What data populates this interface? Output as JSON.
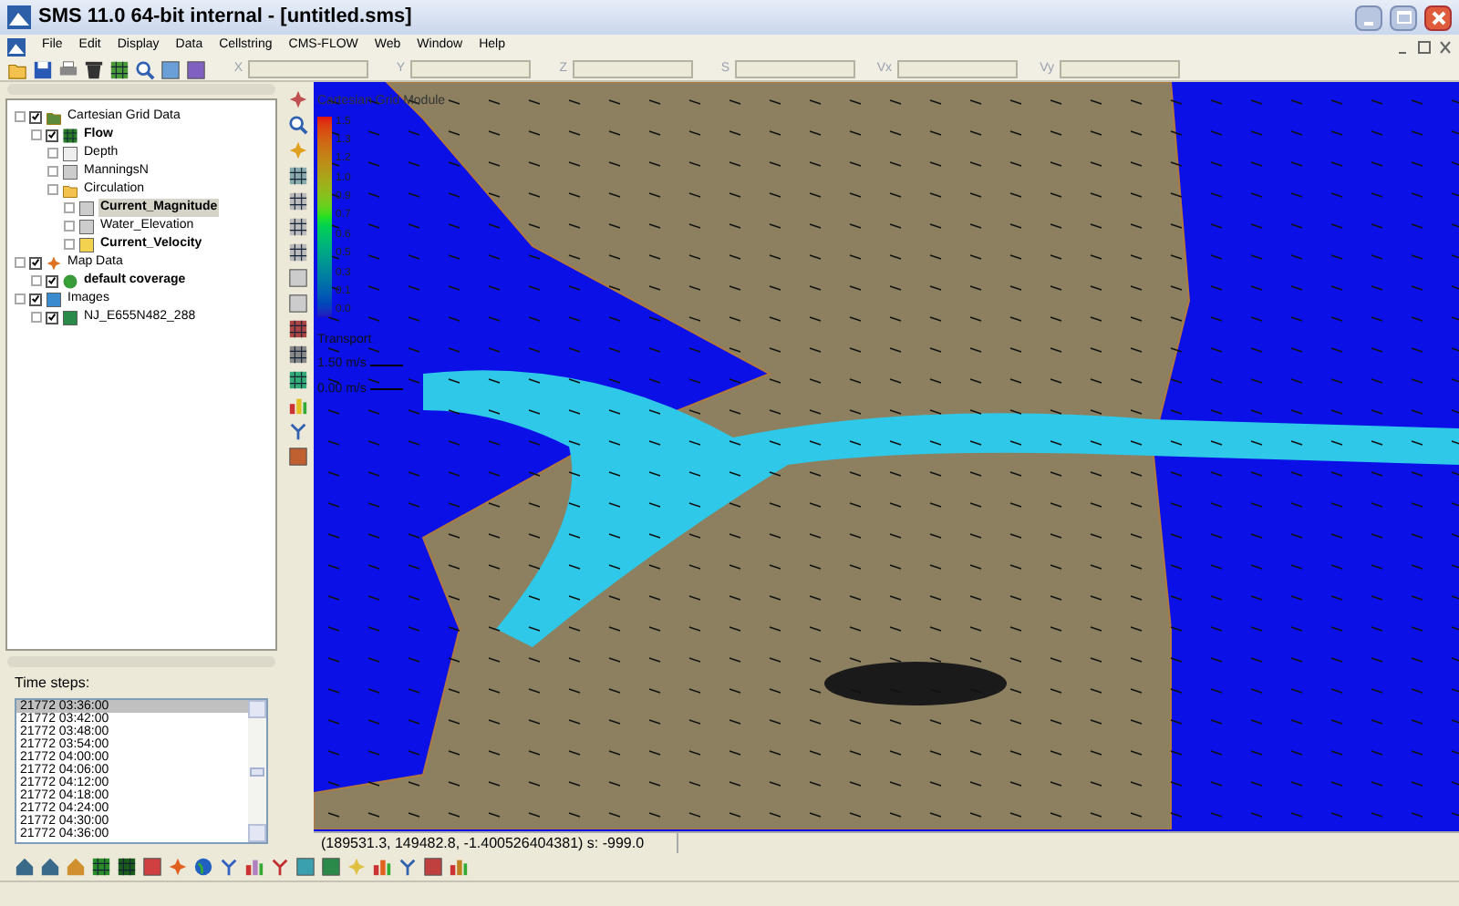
{
  "window": {
    "title": "SMS 11.0 64-bit internal - [untitled.sms]"
  },
  "menu": [
    "File",
    "Edit",
    "Display",
    "Data",
    "Cellstring",
    "CMS-FLOW",
    "Web",
    "Window",
    "Help"
  ],
  "coord_fields": [
    {
      "label": "X"
    },
    {
      "label": "Y"
    },
    {
      "label": "Z"
    },
    {
      "label": "S"
    },
    {
      "label": "Vx"
    },
    {
      "label": "Vy"
    }
  ],
  "tree": [
    {
      "label": "Cartesian Grid Data",
      "kind": "gridfolder",
      "checked": true,
      "bold": false,
      "selected": false,
      "children": [
        {
          "label": "Flow",
          "kind": "grid",
          "checked": true,
          "bold": true,
          "selected": false,
          "children": [
            {
              "label": "Depth",
              "kind": "z",
              "bold": false,
              "selected": false
            },
            {
              "label": "ManningsN",
              "kind": "scalar",
              "bold": false,
              "selected": false
            },
            {
              "label": "Circulation",
              "kind": "folder",
              "bold": false,
              "selected": false,
              "children": [
                {
                  "label": "Current_Magnitude",
                  "kind": "scalar",
                  "bold": true,
                  "selected": true
                },
                {
                  "label": "Water_Elevation",
                  "kind": "scalar",
                  "bold": false,
                  "selected": false
                },
                {
                  "label": "Current_Velocity",
                  "kind": "vector",
                  "bold": true,
                  "selected": false
                }
              ]
            }
          ]
        }
      ]
    },
    {
      "label": "Map Data",
      "kind": "map",
      "checked": true,
      "bold": false,
      "selected": false,
      "children": [
        {
          "label": "default coverage",
          "kind": "coverage",
          "checked": true,
          "bold": true,
          "selected": false
        }
      ]
    },
    {
      "label": "Images",
      "kind": "images",
      "checked": true,
      "bold": false,
      "selected": false,
      "children": [
        {
          "label": "NJ_E655N482_288",
          "kind": "image",
          "checked": true,
          "bold": false,
          "selected": false
        }
      ]
    }
  ],
  "time_steps": {
    "label": "Time steps:",
    "items": [
      {
        "text": "21772 03:36:00",
        "selected": true
      },
      {
        "text": "21772 03:42:00",
        "selected": false
      },
      {
        "text": "21772 03:48:00",
        "selected": false
      },
      {
        "text": "21772 03:54:00",
        "selected": false
      },
      {
        "text": "21772 04:00:00",
        "selected": false
      },
      {
        "text": "21772 04:06:00",
        "selected": false
      },
      {
        "text": "21772 04:12:00",
        "selected": false
      },
      {
        "text": "21772 04:18:00",
        "selected": false
      },
      {
        "text": "21772 04:24:00",
        "selected": false
      },
      {
        "text": "21772 04:30:00",
        "selected": false
      },
      {
        "text": "21772 04:36:00",
        "selected": false
      }
    ]
  },
  "map": {
    "title": "Cartesian Grid Module",
    "legend": [
      "1.5",
      "1.3",
      "1.2",
      "1.0",
      "0.9",
      "0.7",
      "0.6",
      "0.5",
      "0.3",
      "0.1",
      "0.0"
    ],
    "vector_legend": {
      "title": "Transport",
      "max": "1.50 m/s",
      "min": "0.00 m/s"
    }
  },
  "status_bar": {
    "coordinates": "(189531.3, 149482.8, -1.400526404381) s: -999.0"
  }
}
